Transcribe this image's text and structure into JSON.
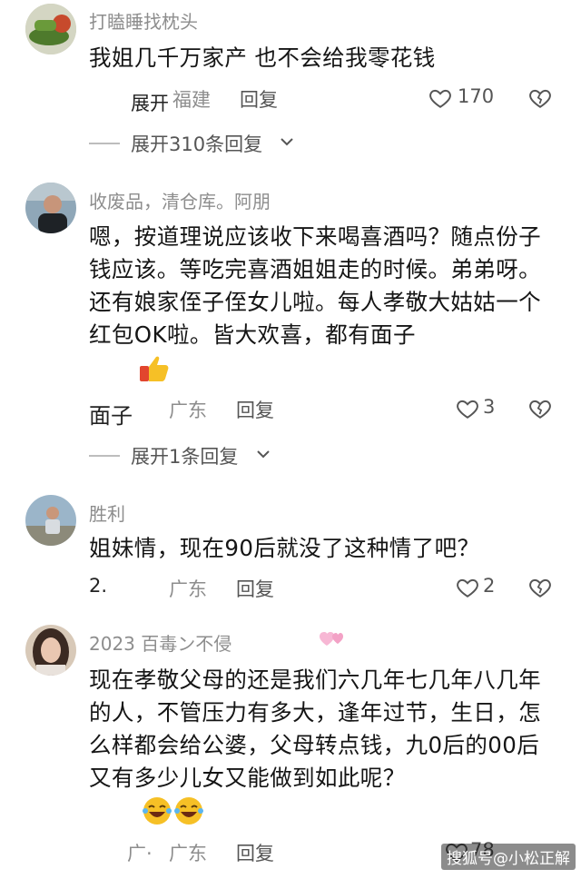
{
  "comments": [
    {
      "username": "打瞌睡找枕头",
      "text": "我姐几千万家产 也不会给我零花钱",
      "time": "展开",
      "location": "福建",
      "reply_label": "回复",
      "likes": "170",
      "expand_label": "展开310条回复"
    },
    {
      "username": "收废品，清仓库。阿朋",
      "text": "嗯，按道理说应该收下来喝喜酒吗？随点份子钱应该。等吃完喜酒姐姐走的时候。弟弟呀。还有娘家侄子侄女儿啦。每人孝敬大姑姑一个红包OK啦。皆大欢喜，都有面子",
      "time": "面子",
      "location": "广东",
      "reply_label": "回复",
      "likes": "3",
      "expand_label": "展开1条回复"
    },
    {
      "username": "胜利",
      "text": "姐妹情，现在90后就没了这种情了吧？",
      "time": "2.",
      "location": "广东",
      "reply_label": "回复",
      "likes": "2"
    },
    {
      "username": "2023 百毒ン不侵",
      "text": "现在孝敬父母的还是我们六几年七几年八几年的人，不管压力有多大，逢年过节，生日，怎么样都会给公婆，父母转点钱，九0后的00后又有多少儿女又能做到如此呢？",
      "time": "广·",
      "location": "广东",
      "reply_label": "回复",
      "likes": "78"
    }
  ],
  "watermark": "搜狐号@小松正解",
  "colors": {
    "meta_gray": "#8d8d8d",
    "text_dark": "#151515",
    "emoji_yellow": "#f6c026"
  }
}
